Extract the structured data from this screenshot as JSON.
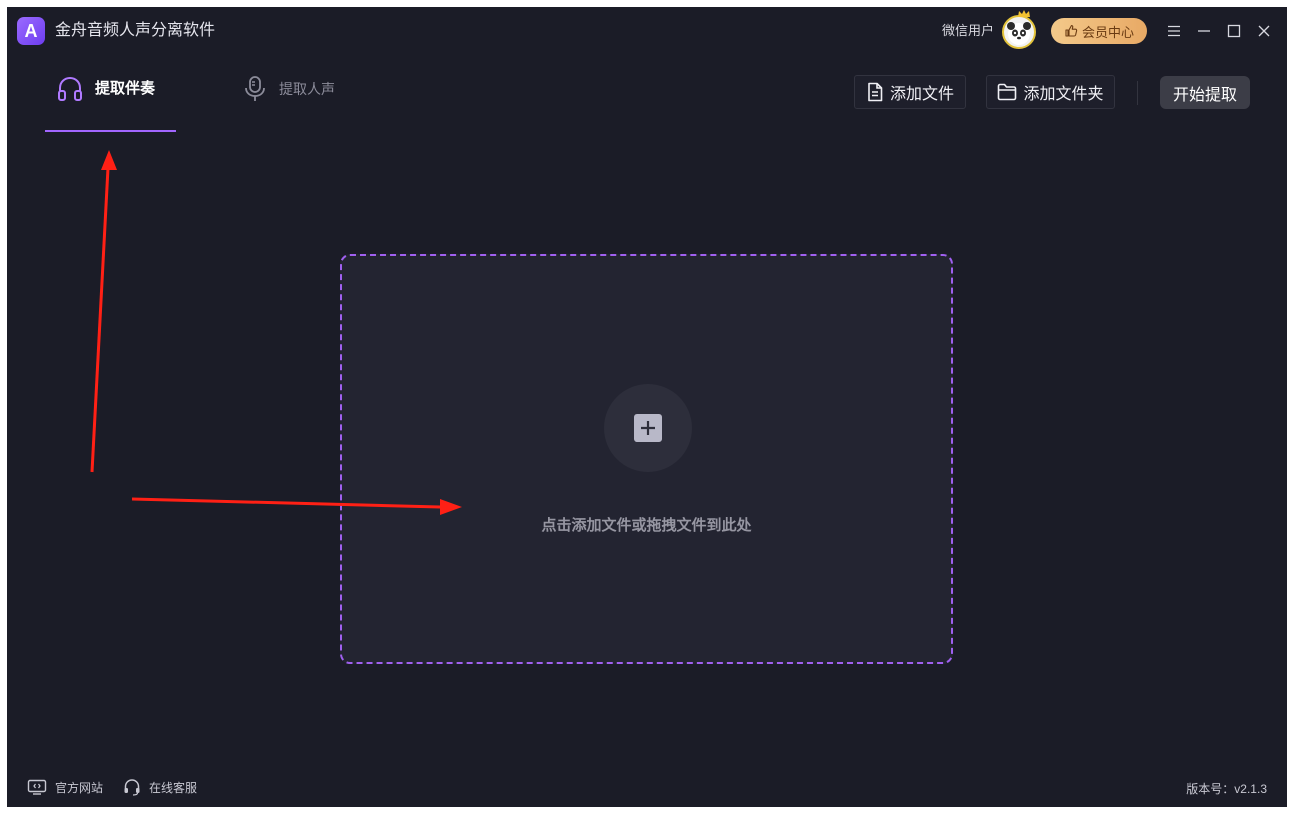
{
  "app": {
    "title": "金舟音频人声分离软件",
    "logo_letter": "A",
    "accent": "#a266ff"
  },
  "user": {
    "name": "微信用户",
    "vip_label": "会员中心"
  },
  "window_controls": [
    "menu-icon",
    "minimize-icon",
    "maximize-icon",
    "close-icon"
  ],
  "tabs": [
    {
      "label": "提取伴奏",
      "icon": "headphones-icon",
      "active": true
    },
    {
      "label": "提取人声",
      "icon": "microphone-icon",
      "active": false
    }
  ],
  "toolbar": {
    "add_file": "添加文件",
    "add_folder": "添加文件夹",
    "start": "开始提取"
  },
  "dropzone": {
    "hint": "点击添加文件或拖拽文件到此处"
  },
  "footer": {
    "website": "官方网站",
    "support": "在线客服",
    "version": "版本号：v2.1.3"
  }
}
